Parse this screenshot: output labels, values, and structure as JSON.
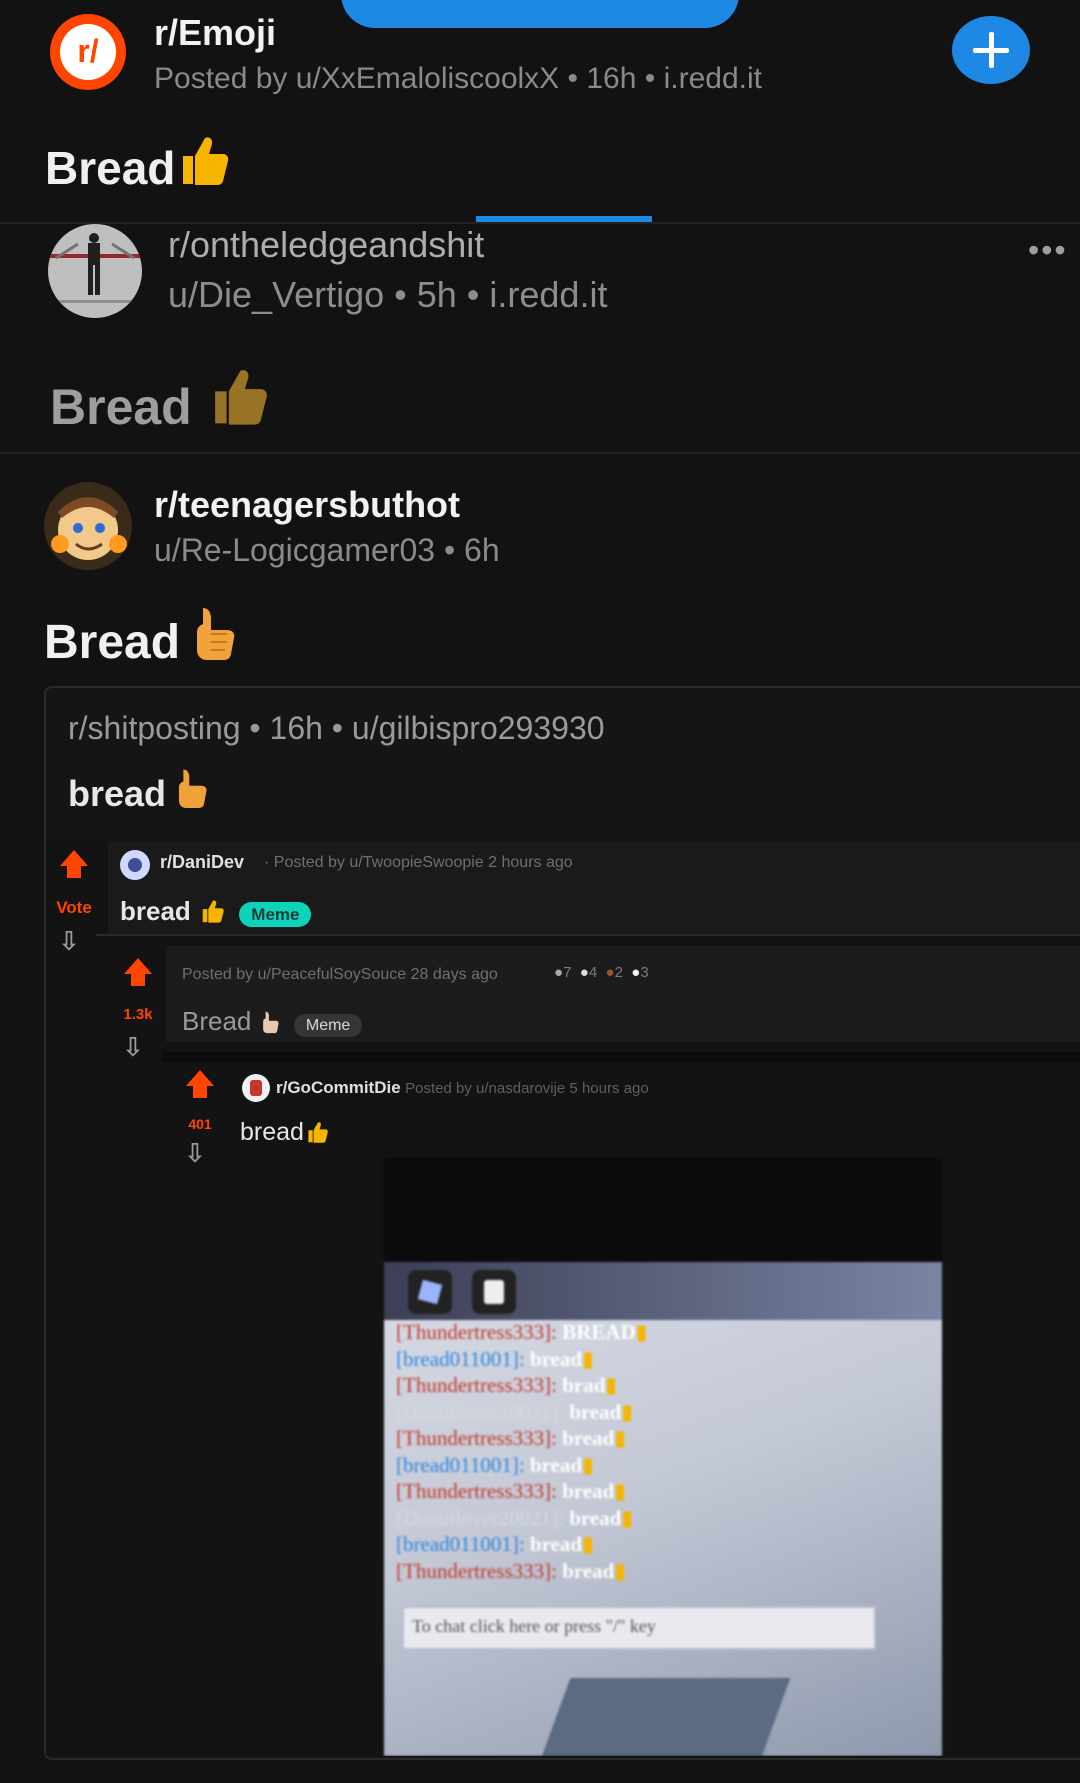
{
  "post1": {
    "avatar_text": "r/",
    "subreddit": "r/Emoji",
    "meta": "Posted by u/XxEmaloliscoolxX • 16h • i.redd.it",
    "title": "Bread"
  },
  "post2": {
    "subreddit": "r/ontheledgeandshit",
    "meta": "u/Die_Vertigo • 5h • i.redd.it",
    "title": "Bread"
  },
  "post3": {
    "subreddit": "r/teenagersbuthot",
    "meta": "u/Re-Logicgamer03 • 6h",
    "title": "Bread"
  },
  "crosspost": {
    "meta": "r/shitposting • 16h • u/gilbispro293930",
    "title": "bread"
  },
  "nested1": {
    "vote_label": "Vote",
    "subreddit": "r/DaniDev",
    "meta": "· Posted by u/TwoopieSwoopie 2 hours ago",
    "title": "bread",
    "flair": "Meme"
  },
  "nested2": {
    "votes": "1.3k",
    "meta": "Posted by u/PeacefulSoySouce 28 days ago",
    "award_counts": [
      "7",
      "4",
      "2",
      "3"
    ],
    "title": "Bread",
    "flair": "Meme"
  },
  "nested3": {
    "votes": "401",
    "subreddit": "r/GoCommitDie",
    "meta": "· Posted by u/nasdarovije 5 hours ago",
    "title": "bread"
  },
  "game_chat": {
    "lines": [
      {
        "name": "[Thundertress333]:",
        "msg": "BREAD",
        "color": "#c0392b"
      },
      {
        "name": "[bread011001]:",
        "msg": "bread",
        "color": "#2e86de"
      },
      {
        "name": "[Thundertress333]:",
        "msg": "brad",
        "color": "#c0392b"
      },
      {
        "name": "[Donutlover20021]:",
        "msg": "bread",
        "color": "#d8d8d8"
      },
      {
        "name": "[Thundertress333]:",
        "msg": "bread",
        "color": "#c0392b"
      },
      {
        "name": "[bread011001]:",
        "msg": "bread",
        "color": "#2e86de"
      },
      {
        "name": "[Thundertress333]:",
        "msg": "bread",
        "color": "#c0392b"
      },
      {
        "name": "[Donutlover20021]:",
        "msg": "bread",
        "color": "#d8d8d8"
      },
      {
        "name": "[bread011001]:",
        "msg": "bread",
        "color": "#2e86de"
      },
      {
        "name": "[Thundertress333]:",
        "msg": "bread",
        "color": "#c0392b"
      }
    ],
    "input_placeholder": "To chat click here or press \"/\" key"
  },
  "colors": {
    "background": "#121212",
    "accent_blue": "#1e88e5",
    "reddit_orange": "#ff4500",
    "meme_flair": "#0dd3bb"
  },
  "icons": [
    "subreddit-avatar-icon",
    "add-icon",
    "more-options-icon",
    "thumbs-up-icon",
    "upvote-icon",
    "downvote-icon"
  ]
}
